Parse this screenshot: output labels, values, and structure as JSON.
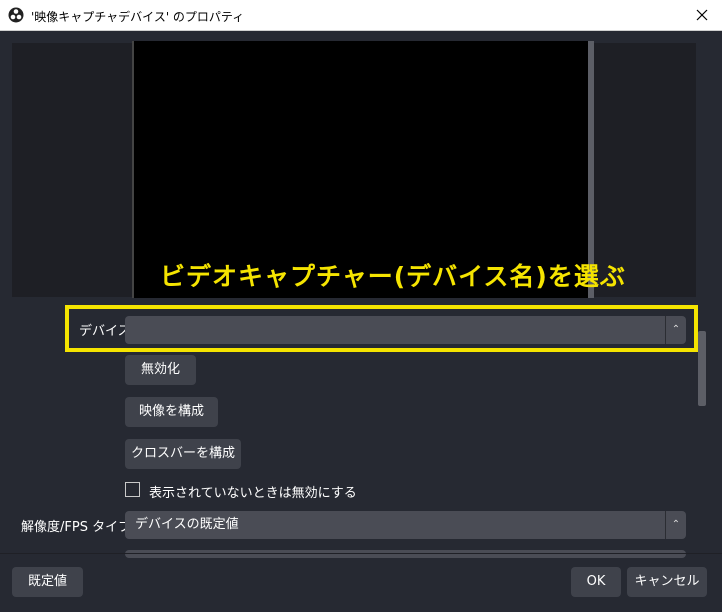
{
  "window": {
    "title": "'映像キャプチャデバイス' のプロパティ",
    "close_icon": "close-icon",
    "app_icon": "obs-logo-icon"
  },
  "preview": {
    "overlay_text": "ビデオキャプチャー(デバイス名)を選ぶ",
    "overlay_color": "#f5e400"
  },
  "form": {
    "device_label": "デバイス",
    "device_value": "",
    "deactivate_button": "無効化",
    "configure_video_button": "映像を構成",
    "configure_crossbar_button": "クロスバーを構成",
    "hide_when_inactive_label": "表示されていないときは無効にする",
    "hide_when_inactive_checked": false,
    "resolution_label": "解像度/FPS タイプ",
    "resolution_value": "デバイスの既定値"
  },
  "footer": {
    "defaults_button": "既定値",
    "ok_button": "OK",
    "cancel_button": "キャンセル"
  }
}
